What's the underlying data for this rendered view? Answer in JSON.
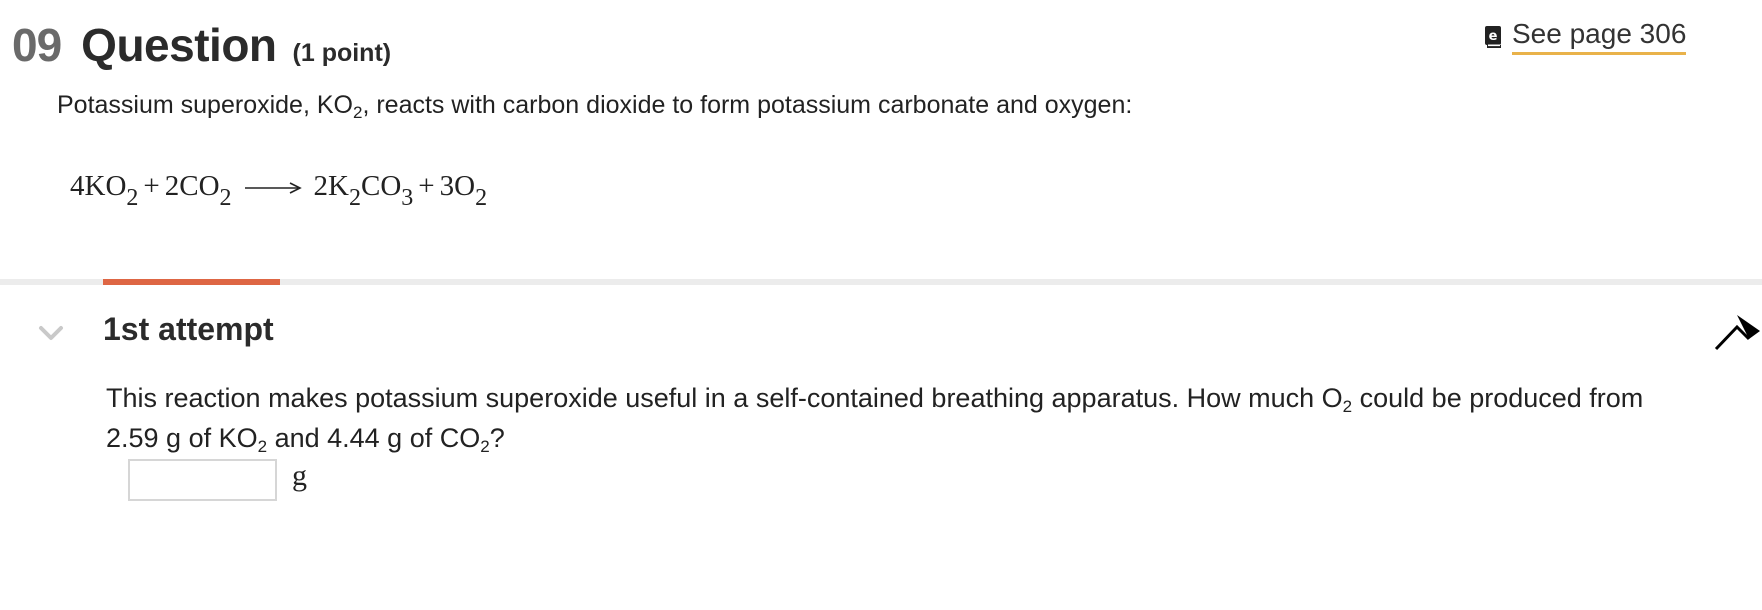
{
  "question": {
    "number": "09",
    "title": "Question",
    "points": "(1 point)"
  },
  "reference": {
    "icon": "book-icon",
    "label": "See page 306"
  },
  "intro": {
    "text_before": "Potassium superoxide, KO",
    "sub": "2",
    "text_after": ", reacts with carbon dioxide to form potassium carbonate and oxygen:"
  },
  "equation": {
    "r1": "4KO",
    "r1_sub": "2",
    "plus1": "+",
    "r2": "2CO",
    "r2_sub": "2",
    "p1a": "2K",
    "p1a_sub": "2",
    "p1b": "CO",
    "p1b_sub": "3",
    "plus2": "+",
    "p2": "3O",
    "p2_sub": "2"
  },
  "attempt": {
    "title": "1st attempt",
    "prompt": {
      "p1": "This reaction makes potassium superoxide useful in a self-contained breathing apparatus. How much O",
      "s1": "2",
      "p2": " could be produced from 2.59 g of KO",
      "s2": "2",
      "p3": " and 4.44 g of CO",
      "s3": "2",
      "p4": "?"
    },
    "answer": {
      "value": "",
      "unit": "g"
    }
  },
  "colors": {
    "accent_tab": "#de6644",
    "link_underline": "#e9b24a",
    "divider": "#ececec"
  }
}
